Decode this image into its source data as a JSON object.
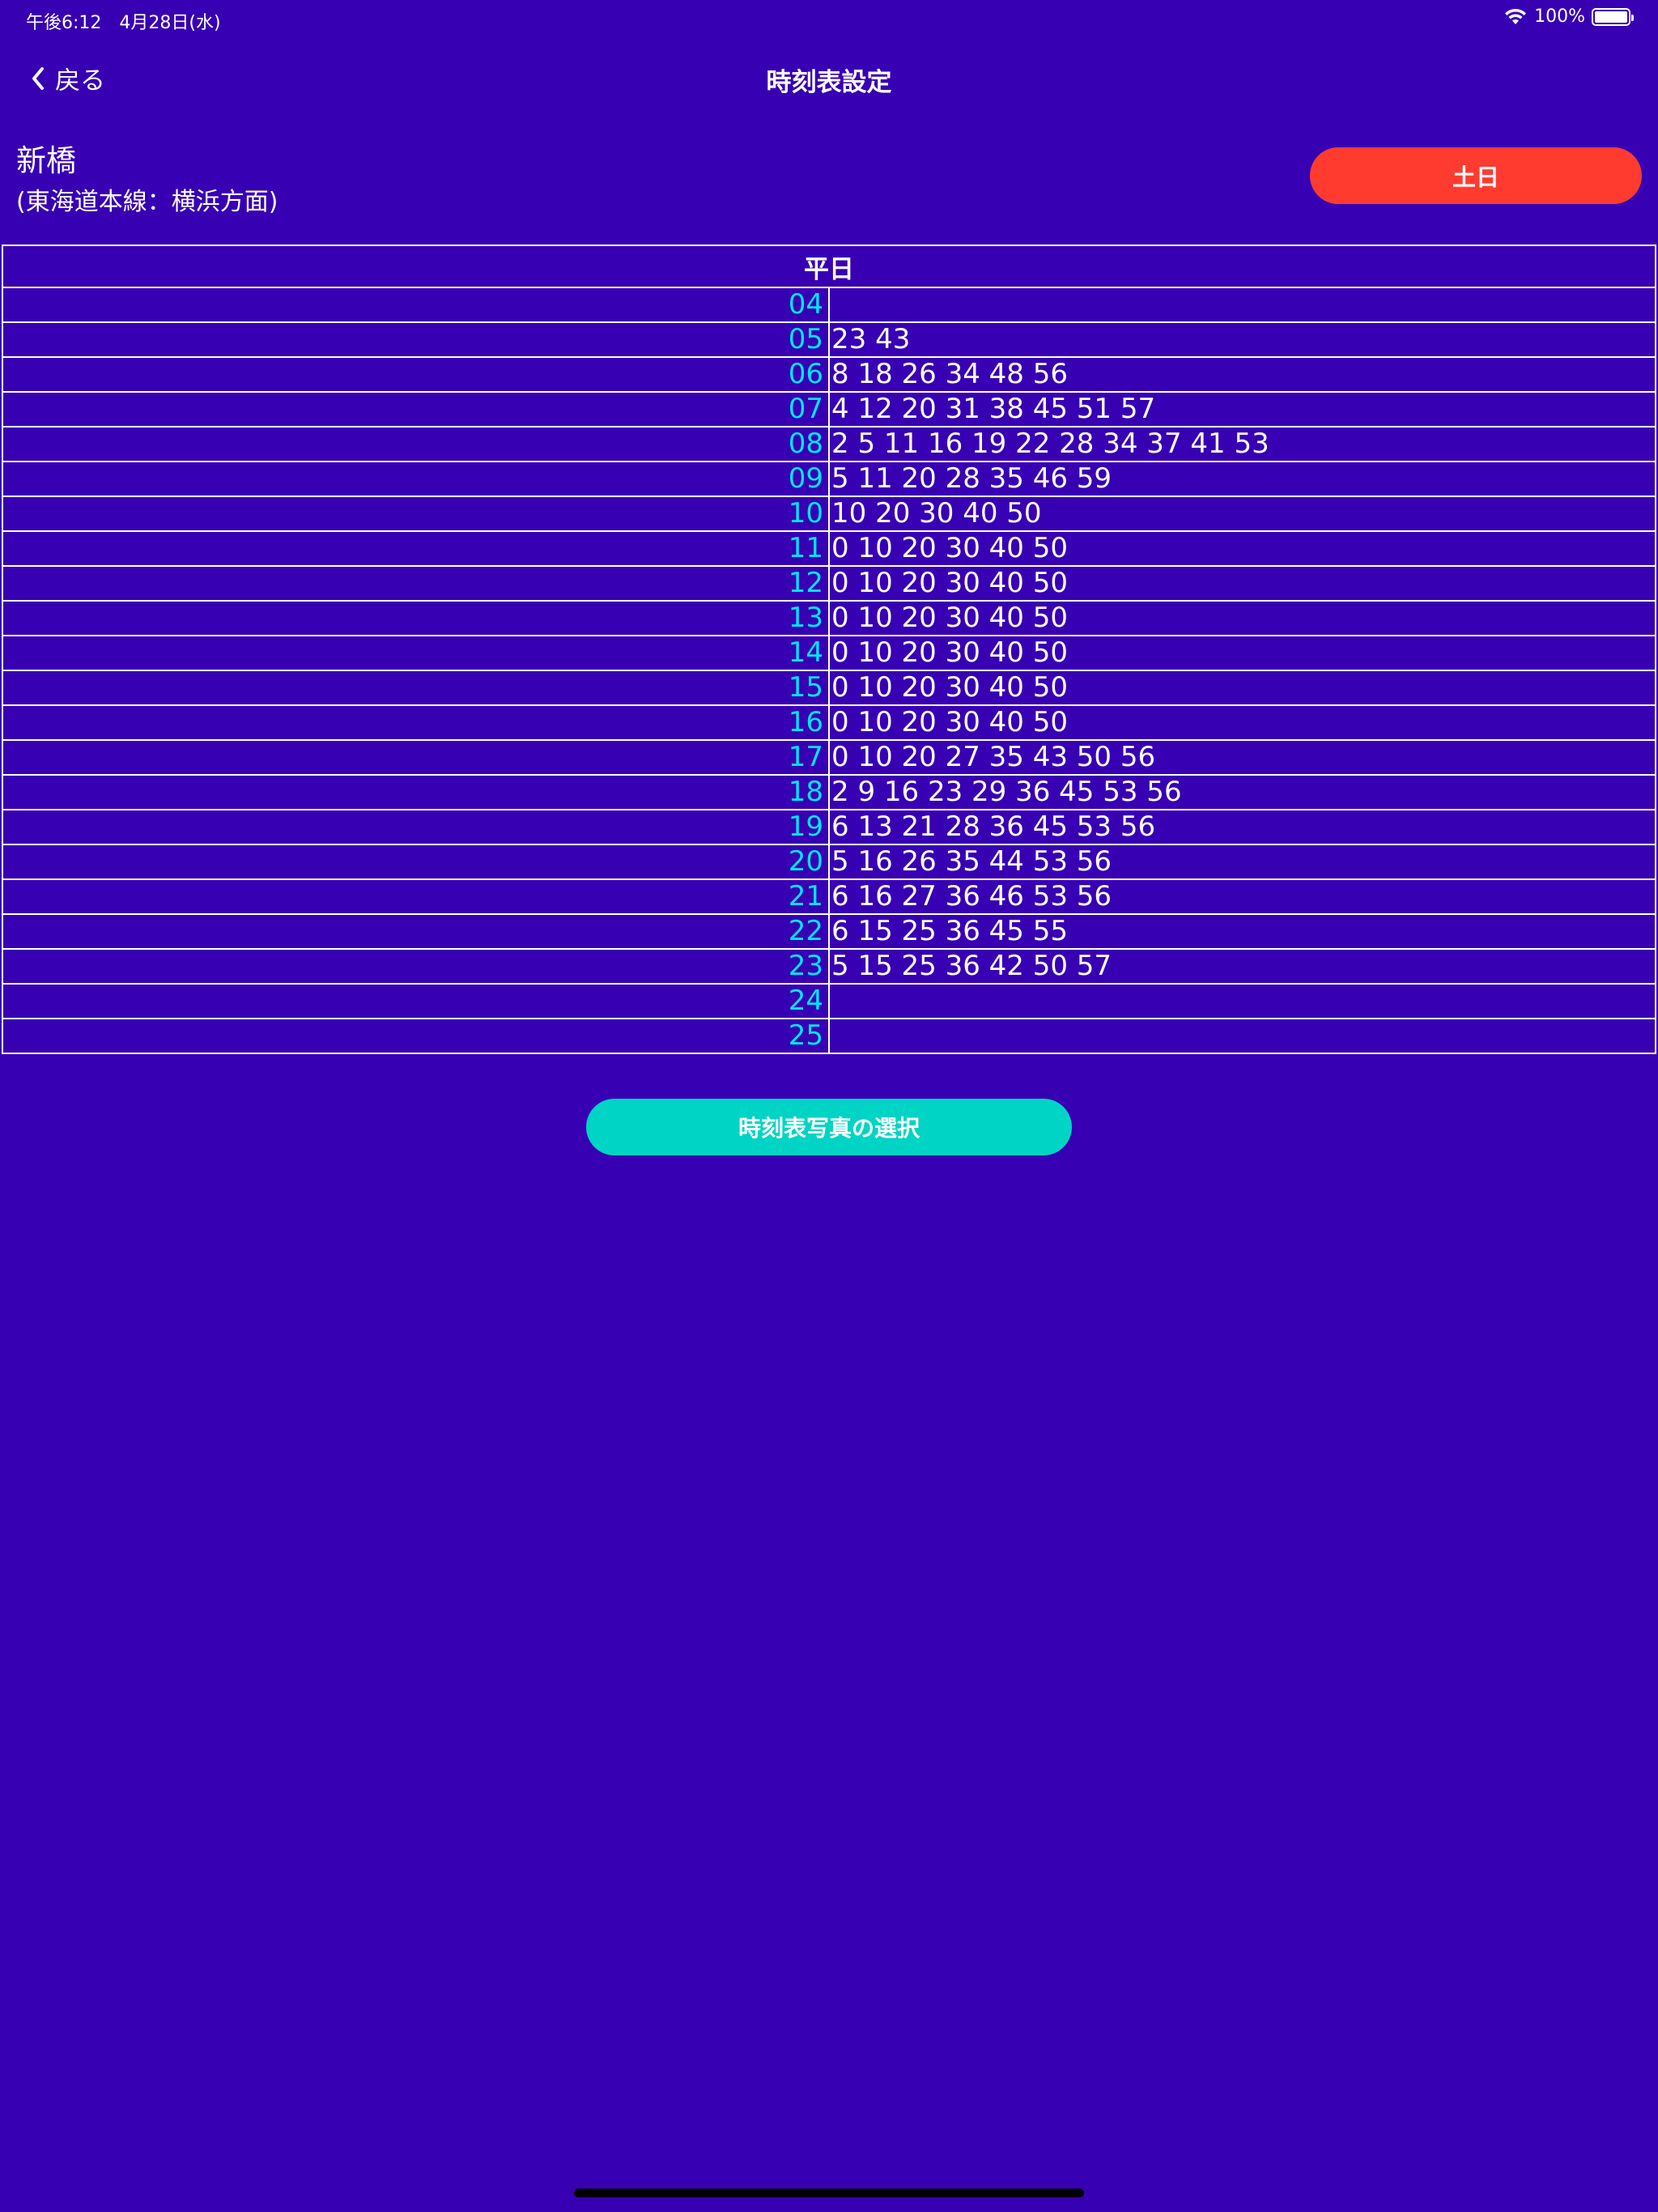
{
  "status_bar": {
    "time_date": "午後6:12　4月28日(水)",
    "battery_percent": "100%",
    "battery_level": 1.0
  },
  "nav": {
    "back_label": "戻る",
    "title": "時刻表設定"
  },
  "station": {
    "name": "新橋",
    "line_direction": "(東海道本線：横浜方面)"
  },
  "day_toggle_label": "土日",
  "timetable": {
    "header": "平日",
    "rows": [
      {
        "hour": "04",
        "minutes": ""
      },
      {
        "hour": "05",
        "minutes": "23 43"
      },
      {
        "hour": "06",
        "minutes": "8 18 26 34 48 56"
      },
      {
        "hour": "07",
        "minutes": "4 12 20 31 38 45 51 57"
      },
      {
        "hour": "08",
        "minutes": "2 5 11 16 19 22 28 34 37 41 53"
      },
      {
        "hour": "09",
        "minutes": "5 11 20 28 35 46 59"
      },
      {
        "hour": "10",
        "minutes": "10 20 30 40 50"
      },
      {
        "hour": "11",
        "minutes": "0 10 20 30 40 50"
      },
      {
        "hour": "12",
        "minutes": "0 10 20 30 40 50"
      },
      {
        "hour": "13",
        "minutes": "0 10 20 30 40 50"
      },
      {
        "hour": "14",
        "minutes": "0 10 20 30 40 50"
      },
      {
        "hour": "15",
        "minutes": "0 10 20 30 40 50"
      },
      {
        "hour": "16",
        "minutes": "0 10 20 30 40 50"
      },
      {
        "hour": "17",
        "minutes": "0 10 20 27 35 43 50 56"
      },
      {
        "hour": "18",
        "minutes": "2 9 16 23 29 36 45 53 56"
      },
      {
        "hour": "19",
        "minutes": "6 13 21 28 36 45 53 56"
      },
      {
        "hour": "20",
        "minutes": "5 16 26 35 44 53 56"
      },
      {
        "hour": "21",
        "minutes": "6 16 27 36 46 53 56"
      },
      {
        "hour": "22",
        "minutes": "6 15 25 36 45 55"
      },
      {
        "hour": "23",
        "minutes": "5 15 25 36 42 50 57"
      },
      {
        "hour": "24",
        "minutes": ""
      },
      {
        "hour": "25",
        "minutes": ""
      }
    ]
  },
  "photo_select_label": "時刻表写真の選択",
  "colors": {
    "background": "#3800b3",
    "hour_text": "#00e5ff",
    "day_toggle": "#ff3b30",
    "photo_button": "#00d4c4"
  },
  "icons": [
    "wifi-icon",
    "battery-icon",
    "chevron-left-icon"
  ]
}
